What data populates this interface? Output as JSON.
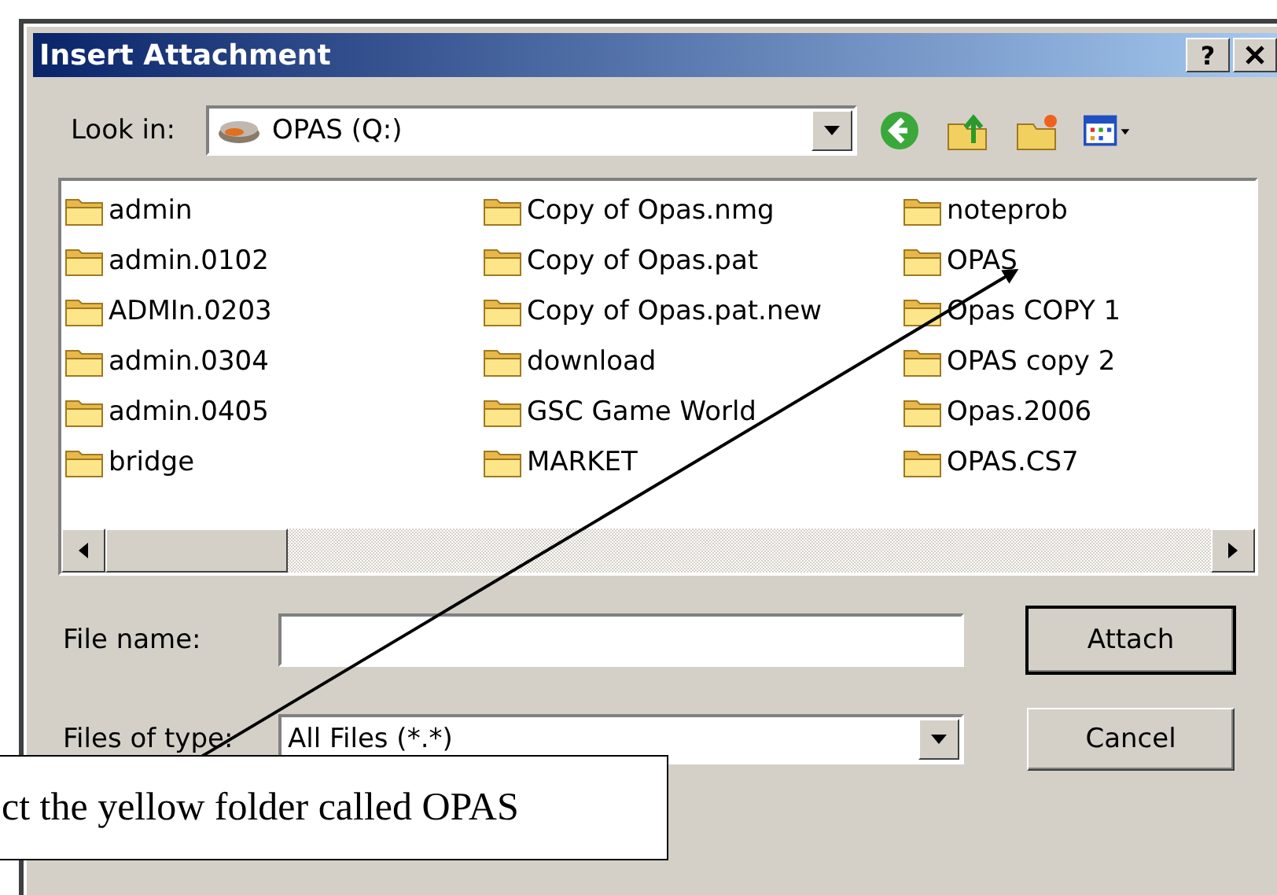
{
  "window": {
    "title": "Insert Attachment",
    "help": "?"
  },
  "look_in": {
    "label": "Look in:",
    "value": "OPAS (Q:)"
  },
  "files": [
    {
      "name": "admin"
    },
    {
      "name": "admin.0102"
    },
    {
      "name": "ADMIn.0203"
    },
    {
      "name": "admin.0304"
    },
    {
      "name": "admin.0405"
    },
    {
      "name": "bridge"
    },
    {
      "name": "Copy of Opas.nmg"
    },
    {
      "name": "Copy of Opas.pat"
    },
    {
      "name": "Copy of Opas.pat.new"
    },
    {
      "name": "download"
    },
    {
      "name": "GSC Game World"
    },
    {
      "name": "MARKET"
    },
    {
      "name": "noteprob"
    },
    {
      "name": "OPAS"
    },
    {
      "name": "Opas COPY 1"
    },
    {
      "name": "OPAS copy 2"
    },
    {
      "name": "Opas.2006"
    },
    {
      "name": "OPAS.CS7"
    }
  ],
  "file_name": {
    "label": "File name:"
  },
  "file_type": {
    "label": "Files of type:",
    "value": "All Files (*.*)"
  },
  "buttons": [
    {
      "label": "Attach",
      "default": true
    },
    {
      "label": "Cancel",
      "default": false
    }
  ],
  "callout": {
    "text": "ct the yellow folder called OPAS"
  }
}
